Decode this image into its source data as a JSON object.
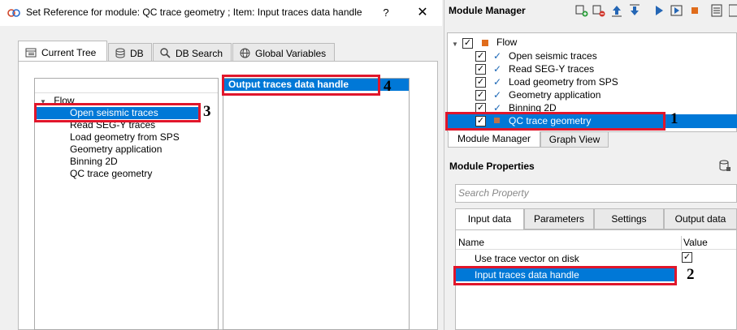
{
  "dialog": {
    "title": "Set Reference for module: QC trace geometry ; Item: Input traces data handle",
    "help_label": "?",
    "close_label": "✕",
    "tabs": [
      {
        "label": "Current Tree",
        "icon": "tree-icon"
      },
      {
        "label": "DB",
        "icon": "database-icon"
      },
      {
        "label": "DB Search",
        "icon": "search-icon"
      },
      {
        "label": "Global Variables",
        "icon": "globe-icon"
      }
    ],
    "tree": {
      "root": "Flow",
      "items": [
        "Open seismic traces",
        "Read SEG-Y traces",
        "Load geometry from SPS",
        "Geometry application",
        "Binning 2D",
        "QC trace geometry"
      ]
    },
    "handles": [
      "Output traces data handle"
    ]
  },
  "module_manager": {
    "title": "Module Manager",
    "tree": {
      "root": "Flow",
      "items": [
        "Open seismic traces",
        "Read SEG-Y traces",
        "Load geometry from SPS",
        "Geometry application",
        "Binning 2D",
        "QC trace geometry"
      ]
    },
    "tabs": [
      "Module Manager",
      "Graph View"
    ]
  },
  "module_properties": {
    "title": "Module Properties",
    "search_placeholder": "Search Property",
    "tabs": [
      "Input data",
      "Parameters",
      "Settings",
      "Output data"
    ],
    "columns": [
      "Name",
      "Value"
    ],
    "rows": [
      {
        "name": "Use trace vector on disk",
        "value": "✓"
      },
      {
        "name": "Input traces data handle",
        "value": ""
      }
    ]
  },
  "annotations": [
    "1",
    "2",
    "3",
    "4"
  ],
  "colors": {
    "selection": "#0078d7",
    "annotation_box": "#e0162b",
    "flow_square": "#e06c1b"
  }
}
